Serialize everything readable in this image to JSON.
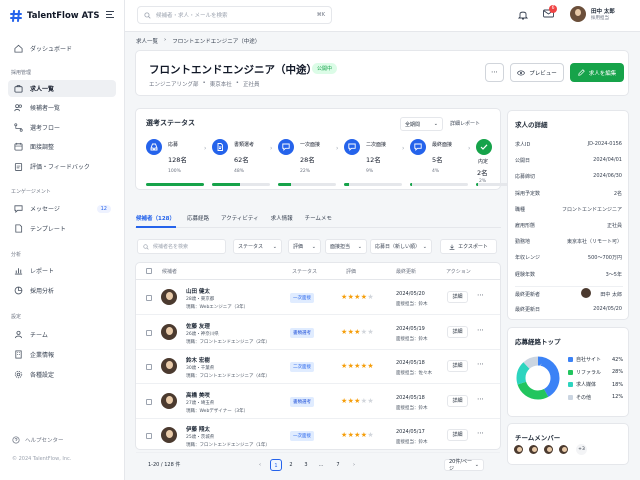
{
  "app": {
    "name": "TalentFlow ATS",
    "copyright": "© 2024 TalentFlow, Inc."
  },
  "sidebar": {
    "dashboard": "ダッシュボード",
    "sections": [
      "採用管理",
      "エンゲージメント",
      "分析",
      "設定"
    ],
    "recruit_items": [
      {
        "label": "求人一覧",
        "icon": "briefcase-icon"
      },
      {
        "label": "候補者一覧",
        "icon": "users-icon"
      },
      {
        "label": "選考フロー",
        "icon": "flow-icon"
      },
      {
        "label": "面接調整",
        "icon": "calendar-icon"
      },
      {
        "label": "評価・フィードバック",
        "icon": "clipboard-icon"
      }
    ],
    "engage_items": [
      {
        "label": "メッセージ",
        "icon": "message-icon",
        "count": "12"
      },
      {
        "label": "テンプレート",
        "icon": "template-icon"
      }
    ],
    "analysis_items": [
      {
        "label": "レポート",
        "icon": "chart-icon"
      },
      {
        "label": "採用分析",
        "icon": "pie-icon"
      }
    ],
    "settings_items": [
      {
        "label": "チーム",
        "icon": "team-icon"
      },
      {
        "label": "企業情報",
        "icon": "building-icon"
      },
      {
        "label": "各種設定",
        "icon": "gear-icon"
      }
    ],
    "help": "ヘルプセンター"
  },
  "topbar": {
    "search_placeholder": "候補者・求人・メールを検索",
    "search_shortcut": "⌘K",
    "mail_badge": "6",
    "user_name": "田中 太郎",
    "user_role": "採用担当"
  },
  "breadcrumb": [
    "求人一覧",
    "›",
    "フロントエンドエンジニア（中途）"
  ],
  "job": {
    "title": "フロントエンドエンジニア（中途）",
    "status": "公開中",
    "meta": [
      "エンジニアリング部",
      "•",
      "東京本社",
      "•",
      "正社員"
    ],
    "more": "⋯",
    "preview": "プレビュー",
    "edit": "求人を編集"
  },
  "pipeline": {
    "title": "選考ステータス",
    "period": "全期間",
    "report": "詳細レポート",
    "stages": [
      {
        "name": "応募",
        "count": "128名",
        "pct": "100%",
        "icon": "inbox-icon",
        "fill": 1.0
      },
      {
        "name": "書類選考",
        "count": "62名",
        "pct": "48%",
        "icon": "document-icon",
        "fill": 0.48
      },
      {
        "name": "一次面接",
        "count": "28名",
        "pct": "22%",
        "icon": "chat-icon",
        "fill": 0.22
      },
      {
        "name": "二次面接",
        "count": "12名",
        "pct": "9%",
        "icon": "chat-icon",
        "fill": 0.09
      },
      {
        "name": "最終面接",
        "count": "5名",
        "pct": "4%",
        "icon": "chat-icon",
        "fill": 0.04
      },
      {
        "name": "内定",
        "count": "2名",
        "pct": "2%",
        "icon": "check-icon",
        "fill": 0.02
      }
    ]
  },
  "tabs": [
    "候補者（128）",
    "応募経路",
    "アクティビティ",
    "求人情報",
    "チームメモ"
  ],
  "filters": {
    "search_placeholder": "候補者名を検索",
    "status": "ステータス",
    "rating": "評価",
    "owner": "面接担当",
    "sort": "応募日（新しい順）",
    "export": "エクスポート"
  },
  "table": {
    "headers": [
      "候補者",
      "ステータス",
      "評価",
      "最終更新",
      "アクション"
    ],
    "rows": [
      {
        "name": "山田 健太",
        "info": "28歳・東京都",
        "job": "現職：Webエンジニア（3年）",
        "status": "一次面接",
        "rating": 4,
        "date": "2024/05/20",
        "owner": "面接担当：鈴木",
        "action": "詳細"
      },
      {
        "name": "佐藤 友理",
        "info": "26歳・神奈川県",
        "job": "現職：フロントエンドエンジニア（2年）",
        "status": "書類選考",
        "rating": 3,
        "date": "2024/05/19",
        "owner": "面接担当：鈴木",
        "action": "詳細"
      },
      {
        "name": "鈴木 宏樹",
        "info": "30歳・千葉県",
        "job": "現職：フロントエンドエンジニア（4年）",
        "status": "二次面接",
        "rating": 5,
        "date": "2024/05/18",
        "owner": "面接担当：佐々木",
        "action": "詳細"
      },
      {
        "name": "高橋 美咲",
        "info": "27歳・埼玉県",
        "job": "現職：Webデザイナー（3年）",
        "status": "書類選考",
        "rating": 3,
        "date": "2024/05/18",
        "owner": "面接担当：鈴木",
        "action": "詳細"
      },
      {
        "name": "伊藤 翔太",
        "info": "25歳・茨城県",
        "job": "現職：フロントエンドエンジニア（1年）",
        "status": "一次面接",
        "rating": 4,
        "date": "2024/05/17",
        "owner": "面接担当：鈴木",
        "action": "詳細"
      }
    ]
  },
  "pagination": {
    "summary": "1-20 / 128 件",
    "prev": "‹",
    "pages": [
      "1",
      "2",
      "3",
      "…",
      "7"
    ],
    "next": "›",
    "page_size": "20件/ページ"
  },
  "details": {
    "title": "求人の詳細",
    "fields": [
      {
        "label": "求人ID",
        "value": "JD-2024-0156"
      },
      {
        "label": "公開日",
        "value": "2024/04/01"
      },
      {
        "label": "応募締切",
        "value": "2024/06/30"
      },
      {
        "label": "採用予定数",
        "value": "2名"
      },
      {
        "label": "職種",
        "value": "フロントエンドエンジニア"
      },
      {
        "label": "雇用形態",
        "value": "正社員"
      },
      {
        "label": "勤務地",
        "value": "東京本社（リモート可）"
      },
      {
        "label": "年収レンジ",
        "value": "500〜700万円"
      },
      {
        "label": "経験年数",
        "value": "3〜5年"
      }
    ],
    "updated_by_label": "最終更新者",
    "updated_by": "田中 太郎",
    "updated_on_label": "最終更新日",
    "updated_on": "2024/05/20"
  },
  "channels": {
    "title": "応募経路トップ",
    "chart_data": {
      "type": "pie",
      "categories": [
        "自社サイト",
        "リファラル",
        "求人媒体",
        "その他"
      ],
      "values": [
        42,
        28,
        18,
        12
      ],
      "colors": [
        "#3b82f6",
        "#22c55e",
        "#2dd4bf",
        "#cbd5e1"
      ]
    },
    "labels": [
      "42%",
      "28%",
      "18%",
      "12%"
    ]
  },
  "team": {
    "title": "チームメンバー",
    "more": "+3"
  }
}
